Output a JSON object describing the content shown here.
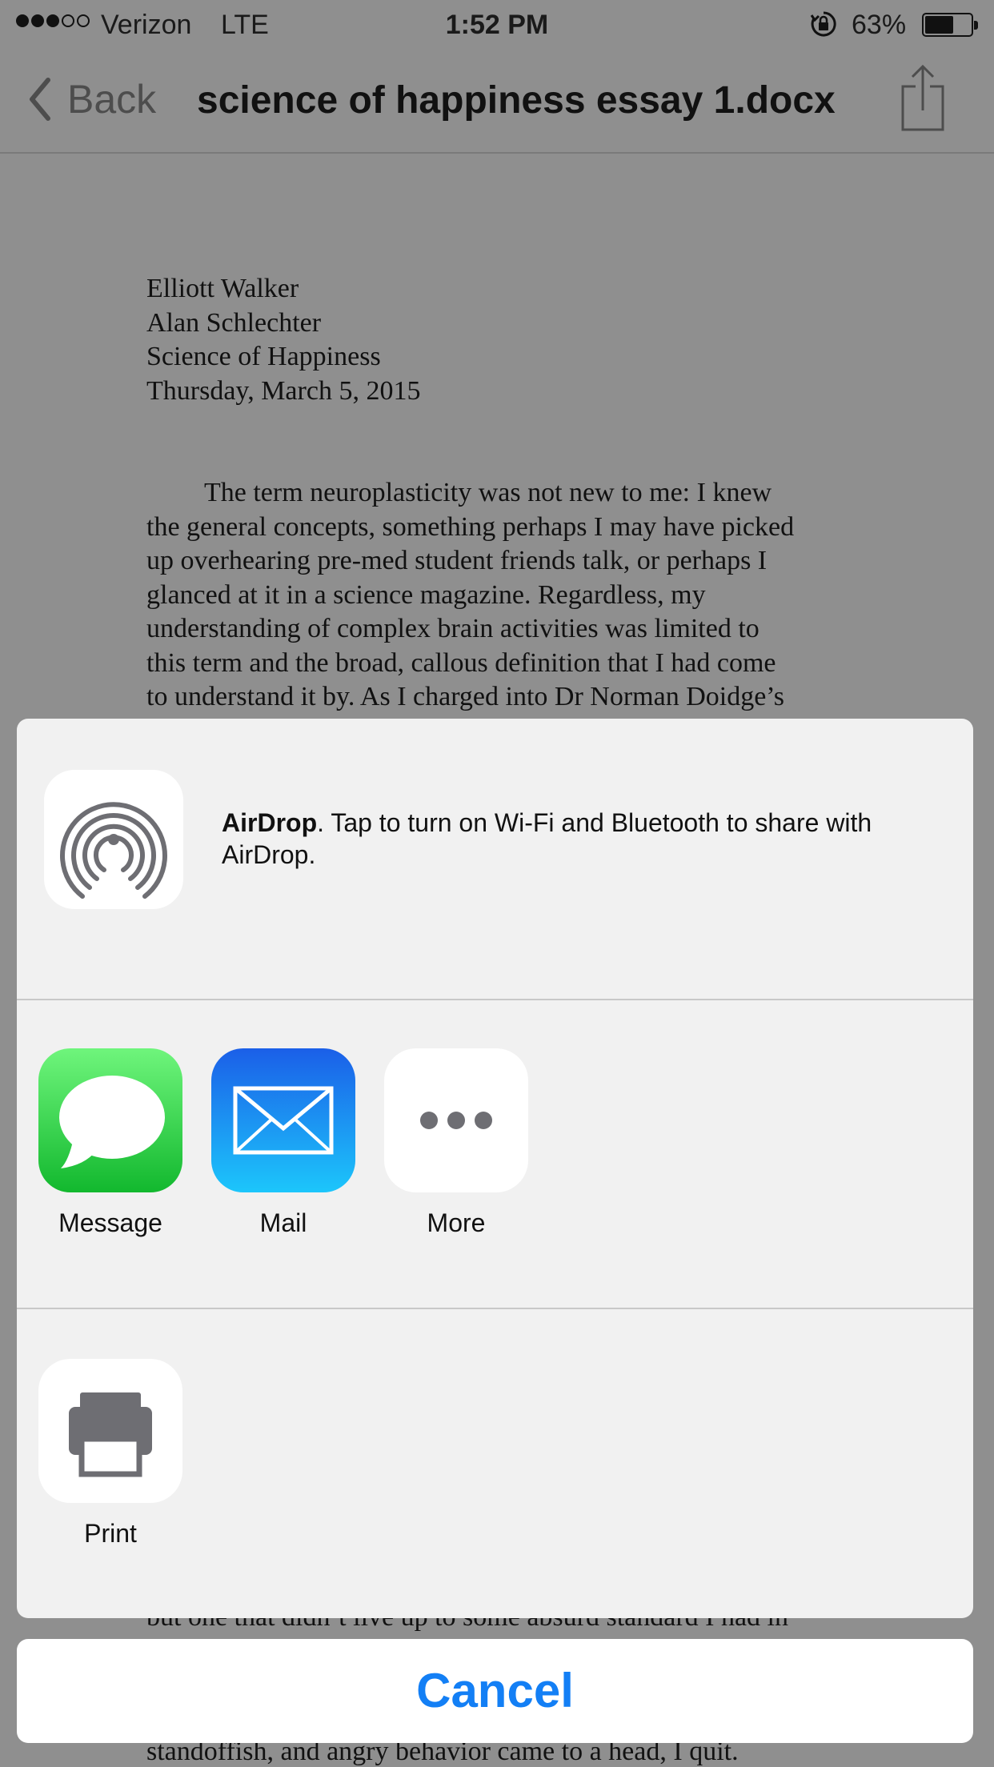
{
  "status_bar": {
    "carrier": "Verizon",
    "network": "LTE",
    "time": "1:52 PM",
    "battery_percent": "63%",
    "battery_level": 0.63,
    "signal_bars_filled": 3,
    "signal_bars_total": 5
  },
  "nav": {
    "back_label": "Back",
    "title": "science of happiness essay 1.docx",
    "share_icon": "share-icon"
  },
  "document": {
    "header_lines": [
      "Elliott Walker",
      "Alan Schlechter",
      "Science of Happiness",
      "Thursday, March 5, 2015"
    ],
    "paragraph_lines": [
      "The term neuroplasticity was not new to me: I knew",
      "the general concepts, something perhaps I may have picked",
      "up overhearing pre-med student friends talk, or perhaps I",
      "glanced at it in a science magazine. Regardless, my",
      "understanding of complex brain activities was limited to",
      "this term and the broad, callous definition that I had come",
      "to understand it by. As I charged into Dr Norman Doidge’s"
    ],
    "tail_line_1": "but one that didn’t live up to some absurd standard I had in",
    "tail_line_2": "standoffish, and angry behavior came to a head, I quit."
  },
  "share_sheet": {
    "airdrop": {
      "title": "AirDrop",
      "message": ". Tap to turn on Wi-Fi and Bluetooth to share with AirDrop.",
      "icon": "airdrop-icon"
    },
    "apps": [
      {
        "label": "Message",
        "icon": "message-icon",
        "color": "#2fc94a"
      },
      {
        "label": "Mail",
        "icon": "mail-icon",
        "color": "#1a8df5"
      },
      {
        "label": "More",
        "icon": "more-icon",
        "color": "#ffffff"
      }
    ],
    "actions": [
      {
        "label": "Print",
        "icon": "print-icon"
      }
    ]
  },
  "cancel_label": "Cancel",
  "colors": {
    "accent": "#137ff5",
    "dimmed_background": "#8f8f8f",
    "sheet_background": "#f1f1f1"
  }
}
